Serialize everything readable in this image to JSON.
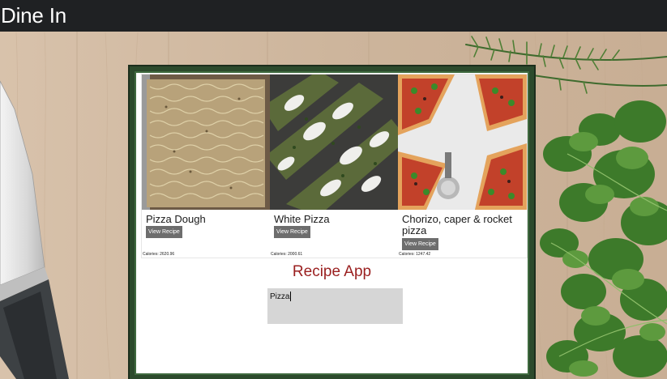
{
  "header": {
    "brand": "Dine In"
  },
  "app": {
    "title": "Recipe App",
    "accent_color": "#9a1f1f",
    "frame_color": "#2c4a2c",
    "search": {
      "value": "Pizza"
    }
  },
  "recipes": [
    {
      "title": "Pizza Dough",
      "button_label": "View Recipe",
      "calories": "Calories: 2620.96"
    },
    {
      "title": "White Pizza",
      "button_label": "View Recipe",
      "calories": "Calories: 2000.61"
    },
    {
      "title": "Chorizo, caper & rocket pizza",
      "button_label": "View Recipe",
      "calories": "Calories: 1247.42"
    }
  ]
}
